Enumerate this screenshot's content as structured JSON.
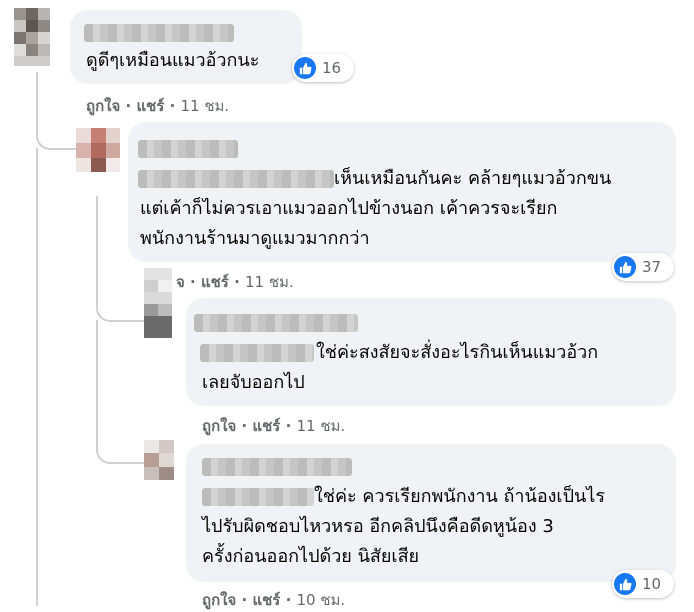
{
  "comments": [
    {
      "id": "c1",
      "text_lines": [
        "ดูดีๆเหมือนแมวอ้วกนะ"
      ],
      "reaction_icon": "like-icon",
      "reaction_count": "16",
      "actions": {
        "like": "ถูกใจ",
        "reply": "แชร์",
        "time": "11 ชม."
      }
    },
    {
      "id": "c2",
      "text_lines": [
        "เห็นเหมือนกันคะ คล้ายๆแมวอ้วกขน",
        "แต่เค้าก็ไม่ควรเอาแมวออกไปข้างนอก เค้าควรจะเรียก",
        "พนักงานร้านมาดูแมวมากกว่า"
      ],
      "reaction_icon": "like-icon",
      "reaction_count": "37",
      "actions": {
        "like": "จ",
        "reply": "แชร์",
        "time": "11 ชม."
      }
    },
    {
      "id": "c3",
      "text_lines": [
        "ใช่ค่ะสงสัยจะสั่งอะไรกินเห็นแมวอ้วก",
        "เลยจับออกไป"
      ],
      "actions": {
        "like": "ถูกใจ",
        "reply": "แชร์",
        "time": "11 ชม."
      }
    },
    {
      "id": "c4",
      "text_lines": [
        "ใช่ค่ะ ควรเรียกพนักงาน ถ้าน้องเป็นไร",
        "ไปรับผิดชอบไหวหรอ อีกคลิปนึงคือดีดหูน้อง 3",
        "ครั้งก่อนออกไปด้วย นิสัยเสีย"
      ],
      "reaction_icon": "like-icon",
      "reaction_count": "10",
      "actions": {
        "like": "ถูกใจ",
        "reply": "แชร์",
        "time": "10 ชม."
      }
    }
  ],
  "colors": {
    "bubble": "#f0f2f5",
    "meta_text": "#65676b",
    "like_blue": "#1877f2",
    "thread_line": "#ced0d4"
  }
}
